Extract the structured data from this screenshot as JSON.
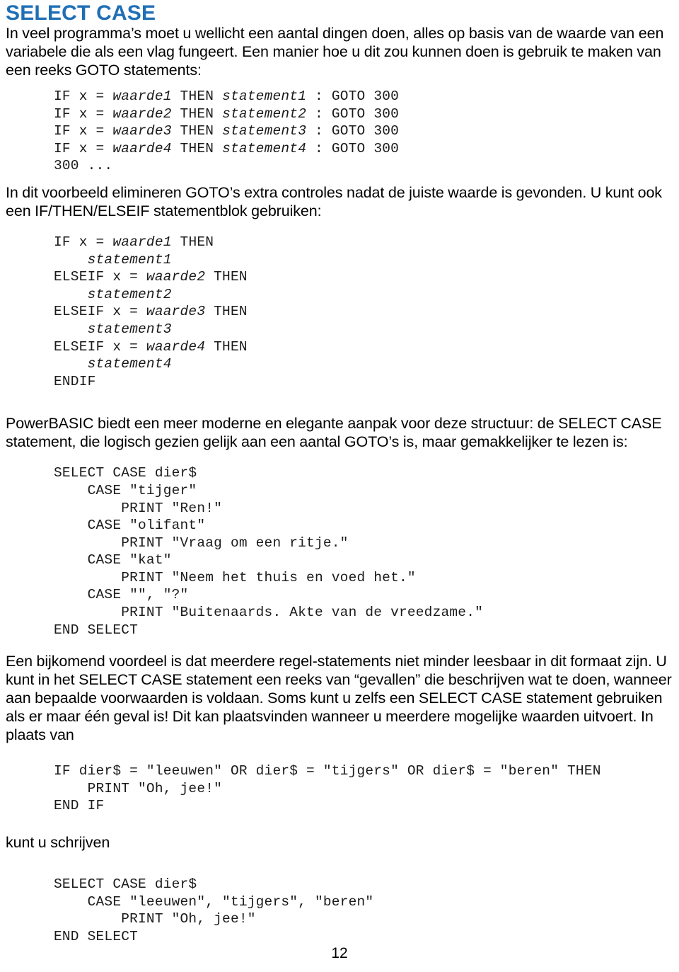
{
  "document": {
    "title": "SELECT CASE",
    "title_color": "#1f6fb5",
    "page_number": "12",
    "paragraphs": {
      "intro": "In veel programma’s moet u wellicht een aantal dingen doen, alles op basis van de waarde van een variabele die als een vlag fungeert. Een manier hoe u dit zou kunnen doen is gebruik te maken van een reeks GOTO statements:",
      "after_goto": "In dit voorbeeld elimineren GOTO’s extra controles nadat de juiste waarde is gevonden. U kunt ook een IF/THEN/ELSEIF statementblok gebruiken:",
      "powerbasic": "PowerBASIC biedt een meer moderne en elegante aanpak voor deze structuur: de SELECT CASE statement, die logisch gezien gelijk aan een aantal GOTO’s is, maar gemakkelijker te lezen is:",
      "advantage": "Een bijkomend voordeel is dat meerdere regel-statements niet minder leesbaar in dit formaat zijn. U kunt in het SELECT CASE statement een reeks van “gevallen” die beschrijven wat te doen, wanneer aan bepaalde voorwaarden is voldaan. Soms kunt u zelfs een SELECT CASE statement gebruiken als er maar één geval is! Dit kan plaatsvinden wanneer u meerdere mogelijke waarden uitvoert. In plaats van",
      "kunt_u_schrijven": "kunt u schrijven"
    },
    "code_blocks": {
      "goto_example": "IF x = waarde1 THEN statement1 : GOTO 300\nIF x = waarde2 THEN statement2 : GOTO 300\nIF x = waarde3 THEN statement3 : GOTO 300\nIF x = waarde4 THEN statement4 : GOTO 300\n300 ...",
      "ifthen_example": "IF x = waarde1 THEN\n    statement1\nELSEIF x = waarde2 THEN\n    statement2\nELSEIF x = waarde3 THEN\n    statement3\nELSEIF x = waarde4 THEN\n    statement4\nENDIF",
      "selectcase_example": "SELECT CASE dier$\n    CASE \"tijger\"\n        PRINT \"Ren!\"\n    CASE \"olifant\"\n        PRINT \"Vraag om een ritje.\"\n    CASE \"kat\"\n        PRINT \"Neem het thuis en voed het.\"\n    CASE \"\", \"?\"\n        PRINT \"Buitenaards. Akte van de vreedzame.\"\nEND SELECT",
      "or_example": "IF dier$ = \"leeuwen\" OR dier$ = \"tijgers\" OR dier$ = \"beren\" THEN\n    PRINT \"Oh, jee!\"\nEND IF",
      "selectcase_multi_example": "SELECT CASE dier$\n    CASE \"leeuwen\", \"tijgers\", \"beren\"\n        PRINT \"Oh, jee!\"\nEND SELECT"
    }
  }
}
